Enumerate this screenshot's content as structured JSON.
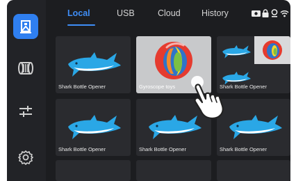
{
  "tabs": [
    {
      "label": "Local",
      "active": true
    },
    {
      "label": "USB",
      "active": false
    },
    {
      "label": "Cloud",
      "active": false
    },
    {
      "label": "History",
      "active": false
    }
  ],
  "sidebar": {
    "items": [
      {
        "icon": "printer-icon",
        "active": true
      },
      {
        "icon": "filament-spool-icon",
        "active": false
      },
      {
        "icon": "adjust-sliders-icon",
        "active": false
      },
      {
        "icon": "settings-gear-icon",
        "active": false
      }
    ]
  },
  "status_icons": [
    "camera-icon",
    "lock-icon",
    "location-icon",
    "wifi-icon"
  ],
  "files": [
    {
      "name": "Shark Bottle Opener",
      "thumb": "shark"
    },
    {
      "name": "Gyroscope toys",
      "thumb": "gyroscope",
      "selected": true
    },
    {
      "name": "Shark Bottle Opener",
      "thumb": "mixed"
    },
    {
      "name": "Shark Bottle Opener",
      "thumb": "shark"
    },
    {
      "name": "Shark Bottle Opener",
      "thumb": "shark"
    },
    {
      "name": "Shark Bottle Opener",
      "thumb": "shark"
    }
  ],
  "colors": {
    "accent": "#2f7ff0",
    "shark_body": "#2aa7e6",
    "background": "#1c1d20",
    "card": "#2a2b2f"
  }
}
